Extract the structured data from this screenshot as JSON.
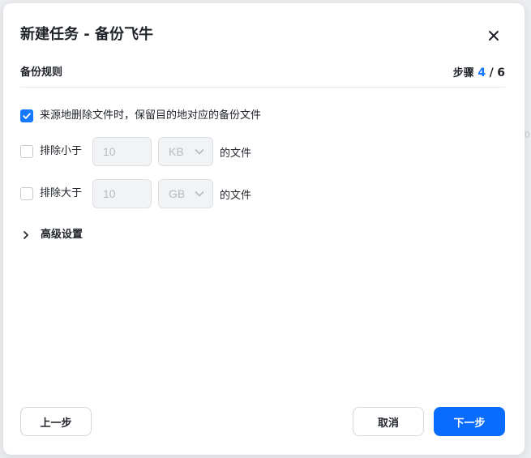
{
  "dialog": {
    "title": "新建任务 - 备份飞牛",
    "section_title": "备份规则",
    "step": {
      "label": "步骤",
      "current": "4",
      "separator": "/",
      "total": "6"
    }
  },
  "rules": {
    "keep_deleted": {
      "label": "来源地删除文件时，保留目的地对应的备份文件",
      "checked": true
    },
    "exclude_smaller": {
      "label": "排除小于",
      "checked": false,
      "value": "10",
      "unit": "KB",
      "suffix": "的文件"
    },
    "exclude_larger": {
      "label": "排除大于",
      "checked": false,
      "value": "10",
      "unit": "GB",
      "suffix": "的文件"
    }
  },
  "advanced": {
    "label": "高级设置"
  },
  "footer": {
    "prev_label": "上一步",
    "cancel_label": "取消",
    "next_label": "下一步"
  },
  "colors": {
    "accent": "#0a6cff",
    "step_current": "#1677ff",
    "text": "#1f2329"
  },
  "icons": {
    "close": "close-icon",
    "check": "check-icon",
    "chevron_down": "chevron-down-icon",
    "chevron_right": "chevron-right-icon"
  }
}
